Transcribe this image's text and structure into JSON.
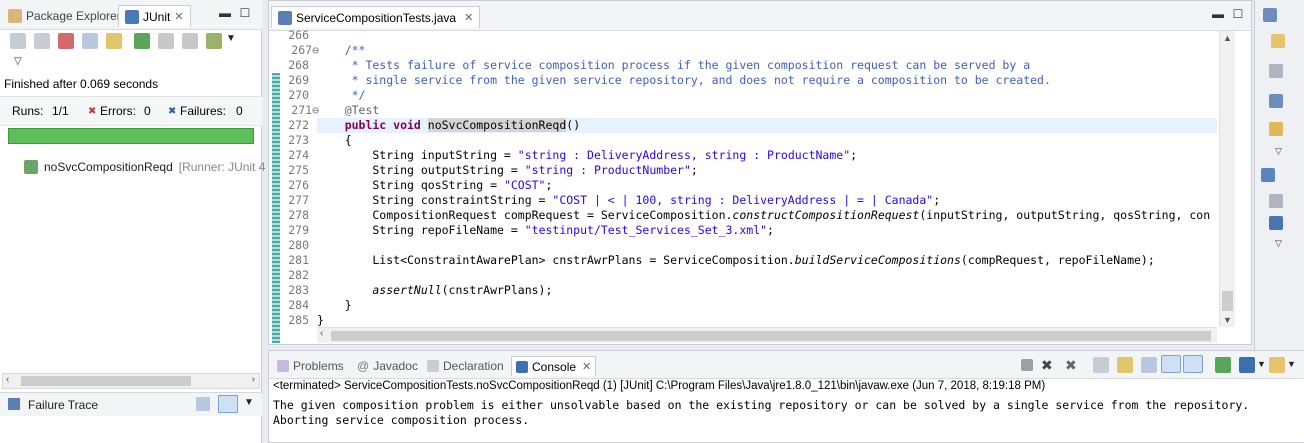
{
  "left_panel": {
    "tabs": [
      {
        "label": "Package Explorer",
        "icon": "package-explorer-icon",
        "active": false
      },
      {
        "label": "JUnit",
        "icon": "junit-icon",
        "active": true
      }
    ],
    "status": "Finished after 0.069 seconds",
    "stats": {
      "runs_label": "Runs:",
      "runs_value": "1/1",
      "errors_label": "Errors:",
      "errors_value": "0",
      "failures_label": "Failures:",
      "failures_value": "0"
    },
    "progress": 1.0,
    "progress_color": "#5fbf5a",
    "tree": [
      {
        "name": "noSvcCompositionReqd",
        "runner": "[Runner: JUnit 4"
      }
    ],
    "failure_trace_label": "Failure Trace"
  },
  "editor": {
    "tab_label": "ServiceCompositionTests.java",
    "lines": [
      {
        "n": "266",
        "fold": false
      },
      {
        "n": "267",
        "fold": true
      },
      {
        "n": "268",
        "fold": false
      },
      {
        "n": "269",
        "fold": false
      },
      {
        "n": "270",
        "fold": false
      },
      {
        "n": "271",
        "fold": true
      },
      {
        "n": "272",
        "fold": false
      },
      {
        "n": "273",
        "fold": false
      },
      {
        "n": "274",
        "fold": false
      },
      {
        "n": "275",
        "fold": false
      },
      {
        "n": "276",
        "fold": false
      },
      {
        "n": "277",
        "fold": false
      },
      {
        "n": "278",
        "fold": false
      },
      {
        "n": "279",
        "fold": false
      },
      {
        "n": "280",
        "fold": false
      },
      {
        "n": "281",
        "fold": false
      },
      {
        "n": "282",
        "fold": false
      },
      {
        "n": "283",
        "fold": false
      },
      {
        "n": "284",
        "fold": false
      },
      {
        "n": "285",
        "fold": false
      }
    ],
    "code": {
      "l267": "    /**",
      "l268": "     * Tests failure of service composition process if the given composition request can be served by a",
      "l269": "     * single service from the given service repository, and does not require a composition to be created.",
      "l270": "     */",
      "l271": "    @Test",
      "l272_kw": "    public void ",
      "l272_name": "noSvcCompositionReqd",
      "l272_rest": "()",
      "l273": "    {",
      "l274_a": "        String inputString = ",
      "l274_s": "\"string : DeliveryAddress, string : ProductName\"",
      "l275_a": "        String outputString = ",
      "l275_s": "\"string : ProductNumber\"",
      "l276_a": "        String qosString = ",
      "l276_s": "\"COST\"",
      "l277_a": "        String constraintString = ",
      "l277_s": "\"COST | < | 100, string : DeliveryAddress | = | Canada\"",
      "l278_a": "        CompositionRequest compRequest = ServiceComposition.",
      "l278_m": "constructCompositionRequest",
      "l278_b": "(inputString, outputString, qosString, con",
      "l279_a": "        String repoFileName = ",
      "l279_s": "\"testinput/Test_Services_Set_3.xml\"",
      "l281_a": "        List<ConstraintAwarePlan> cnstrAwrPlans = ServiceComposition.",
      "l281_m": "buildServiceCompositions",
      "l281_b": "(compRequest, repoFileName);",
      "l283_m": "        assertNull",
      "l283_b": "(cnstrAwrPlans);",
      "l284": "    }",
      "l285": "}"
    },
    "semicolon": ";"
  },
  "console": {
    "tabs": [
      {
        "label": "Problems",
        "active": false
      },
      {
        "label": "Javadoc",
        "active": false
      },
      {
        "label": "Declaration",
        "active": false
      },
      {
        "label": "Console",
        "active": true
      }
    ],
    "terminated": "<terminated> ServiceCompositionTests.noSvcCompositionReqd (1) [JUnit] C:\\Program Files\\Java\\jre1.8.0_121\\bin\\javaw.exe (Jun 7, 2018, 8:19:18 PM)",
    "output": [
      "The given composition problem is either unsolvable based on the existing repository or can be solved by a single service from the repository.",
      "Aborting service composition process."
    ]
  },
  "colors": {
    "keyword": "#7f0055",
    "comment": "#3f5fbf",
    "string": "#2a00ff",
    "progress": "#5fbf5a"
  }
}
